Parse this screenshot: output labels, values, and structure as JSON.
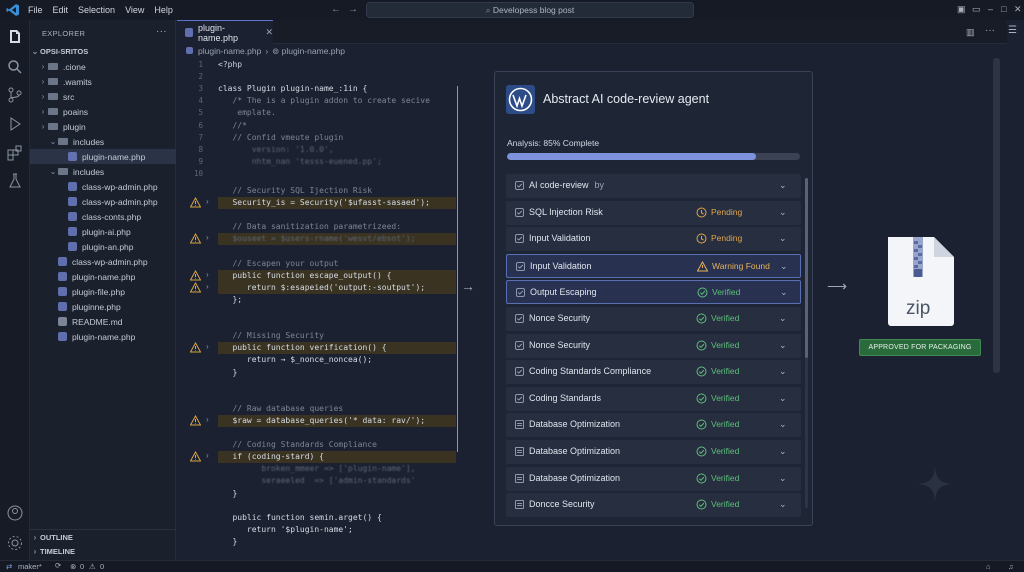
{
  "menu": [
    "File",
    "Edit",
    "Selection",
    "View",
    "Help"
  ],
  "search": {
    "text": "Developess blog post"
  },
  "sidebar": {
    "header": "EXPLORER",
    "project": "OPSI-SRITOS",
    "items": [
      {
        "label": ".cione",
        "type": "folder",
        "depth": 1,
        "chev": "›"
      },
      {
        "label": ".wamits",
        "type": "folder",
        "depth": 1,
        "chev": "›"
      },
      {
        "label": "src",
        "type": "folder",
        "depth": 1,
        "chev": "›"
      },
      {
        "label": "poains",
        "type": "folder",
        "depth": 1,
        "chev": "›"
      },
      {
        "label": "plugin",
        "type": "folder",
        "depth": 1,
        "chev": "›"
      },
      {
        "label": "includes",
        "type": "folder",
        "depth": 2,
        "chev": "⌄"
      },
      {
        "label": "plugin-name.php",
        "type": "php",
        "depth": 3,
        "selected": true
      },
      {
        "label": "includes",
        "type": "folder",
        "depth": 2,
        "chev": "⌄"
      },
      {
        "label": "class-wp-admin.php",
        "type": "php",
        "depth": 3
      },
      {
        "label": "class-wp-admin.php",
        "type": "php",
        "depth": 3
      },
      {
        "label": "class-conts.php",
        "type": "php",
        "depth": 3
      },
      {
        "label": "plugin-ai.php",
        "type": "php",
        "depth": 3
      },
      {
        "label": "plugin-an.php",
        "type": "php",
        "depth": 3
      },
      {
        "label": "class-wp-admin.php",
        "type": "php",
        "depth": 2
      },
      {
        "label": "plugin-name.php",
        "type": "php",
        "depth": 2
      },
      {
        "label": "plugin-file.php",
        "type": "php",
        "depth": 2
      },
      {
        "label": "pluginne.php",
        "type": "php",
        "depth": 2
      },
      {
        "label": "README.md",
        "type": "md",
        "depth": 2
      },
      {
        "label": "plugin-name.php",
        "type": "php",
        "depth": 2
      }
    ],
    "outline": "OUTLINE",
    "timeline": "TIMELINE"
  },
  "editor": {
    "tab": "plugin-name.php",
    "breadcrumb": [
      "plugin-name.php",
      "plugin-name.php"
    ],
    "code_lines": [
      {
        "n": "1",
        "t": "<?php",
        "c": "",
        "top": 0
      },
      {
        "n": "2",
        "t": "",
        "c": ""
      },
      {
        "n": "3",
        "t": "class Plugin plugin-name_:1in {",
        "c": "fn"
      },
      {
        "n": "4",
        "t": "   /* The is a plugin addon to create secive",
        "c": "cm"
      },
      {
        "n": "5",
        "t": "    emplate.",
        "c": "cm"
      },
      {
        "n": "6",
        "t": "   //*",
        "c": "cm"
      },
      {
        "n": "7",
        "t": "   // Confid vmeute plugin",
        "c": "cm"
      },
      {
        "n": "8",
        "t": "       version: '1.0.0',",
        "c": "blur"
      },
      {
        "n": "9",
        "t": "       nhtm_nan 'tesss-euened.pp';",
        "c": "blur"
      },
      {
        "n": "10",
        "t": "",
        "c": ""
      }
    ],
    "code_body": [
      {
        "t": "   // Security SQL Ijection Risk",
        "c": "cm"
      },
      {
        "t": "   Security_is = Security('$ufasst-sasaed');",
        "c": "fn",
        "warn": true
      },
      {
        "t": "",
        "c": ""
      },
      {
        "t": "   // Data sanitization parametrizeed:",
        "c": "cm"
      },
      {
        "t": "   $ouseet = $users-rname('wesvt/ebsot');",
        "c": "blur",
        "warn": true
      },
      {
        "t": "",
        "c": ""
      },
      {
        "t": "   // Escapen your output",
        "c": "cm"
      },
      {
        "t": "   public function escape_output() {",
        "c": "fn",
        "warn": true
      },
      {
        "t": "      return $:esapeied('output:-soutput');",
        "c": "fn",
        "warn": true
      },
      {
        "t": "   };",
        "c": "fn"
      },
      {
        "t": "",
        "c": ""
      },
      {
        "t": "",
        "c": ""
      },
      {
        "t": "   // Missing Security",
        "c": "cm"
      },
      {
        "t": "   public function verification() {",
        "c": "fn",
        "warn": true
      },
      {
        "t": "      return → $_nonce_noncea();",
        "c": "fn"
      },
      {
        "t": "   }",
        "c": "fn"
      },
      {
        "t": "",
        "c": ""
      },
      {
        "t": "",
        "c": ""
      },
      {
        "t": "   // Raw database queries",
        "c": "cm"
      },
      {
        "t": "   $raw = database_queries('* data: rav/');",
        "c": "fn",
        "warn": true
      },
      {
        "t": "",
        "c": ""
      },
      {
        "t": "   // Coding Standards Compliance",
        "c": "cm"
      },
      {
        "t": "   if (coding-stard) {",
        "c": "fn",
        "warn": true
      },
      {
        "t": "         broken_mmeer => ['plugin-name'],",
        "c": "blur"
      },
      {
        "t": "         seraeeled  => ['admin-standards'",
        "c": "blur"
      },
      {
        "t": "   }",
        "c": "fn"
      },
      {
        "t": "",
        "c": ""
      },
      {
        "t": "   public function semin.arget() {",
        "c": "fn"
      },
      {
        "t": "      return '$plugin-name';",
        "c": "fn"
      },
      {
        "t": "   }",
        "c": "fn"
      }
    ]
  },
  "panel": {
    "title": "Abstract AI code-review agent",
    "analysis_label": "Analysis: 85% Complete",
    "progress": 0.85,
    "rows": [
      {
        "label": "AI code-review",
        "sub": "by",
        "status": "",
        "kind": "none",
        "check": true
      },
      {
        "label": "SQL Injection Risk",
        "status": "Pending",
        "kind": "pending",
        "check": true
      },
      {
        "label": "Input Validation",
        "status": "Pending",
        "kind": "pending",
        "check": true
      },
      {
        "label": "Input Validation",
        "status": "Warning Found",
        "kind": "warning",
        "check": true,
        "hi": true
      },
      {
        "label": "Output Escaping",
        "status": "Verified",
        "kind": "verified",
        "check": true,
        "hi": true
      },
      {
        "label": "Nonce Security",
        "status": "Verified",
        "kind": "verified",
        "check": true
      },
      {
        "label": "Nonce Security",
        "status": "Verified",
        "kind": "verified",
        "check": true
      },
      {
        "label": "Coding Standards Compliance",
        "status": "Verified",
        "kind": "verified",
        "check": true
      },
      {
        "label": "Coding Standards",
        "status": "Verified",
        "kind": "verified",
        "check": true
      },
      {
        "label": "Database Optimization",
        "status": "Verified",
        "kind": "verified",
        "check": false
      },
      {
        "label": "Database Optimization",
        "status": "Verified",
        "kind": "verified",
        "check": false
      },
      {
        "label": "Database Optimization",
        "status": "Verified",
        "kind": "verified",
        "check": false
      },
      {
        "label": "Doncce Security",
        "status": "Verified",
        "kind": "verified",
        "check": false
      }
    ]
  },
  "zip": {
    "label": "zip",
    "badge": "APPROVED FOR PACKAGING"
  },
  "status": {
    "branch": "maker*",
    "errors": "0",
    "warnings": "0"
  },
  "colors": {
    "pending": "#e0a54a",
    "warning": "#e8b15a",
    "verified": "#5fbf7a",
    "accent": "#7d91dc"
  }
}
